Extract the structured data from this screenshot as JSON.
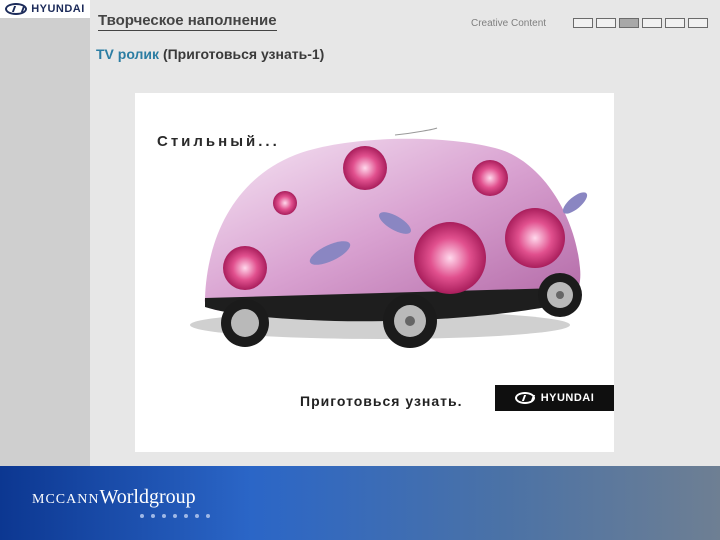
{
  "header": {
    "logo_text": "HYUNDAI",
    "title": "Творческое наполнение",
    "right_label": "Creative Content",
    "progress": {
      "total_steps": 6,
      "active_index": 2
    }
  },
  "subtitle": {
    "accent": "TV ролик",
    "rest": "(Приготовься узнать-1)"
  },
  "ad": {
    "top_text": "Стильный...",
    "bottom_text": "Приготовься узнать.",
    "logo_text": "HYUNDAI"
  },
  "footer": {
    "brand_small": "MCCANN",
    "brand_large": "Worldgroup",
    "dot_count": 7
  }
}
